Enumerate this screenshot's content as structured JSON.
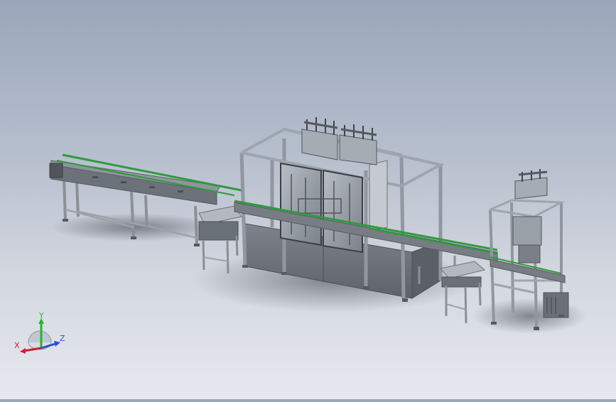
{
  "viewport": {
    "background_top": "#9aa7ba",
    "background_bottom": "#e6e8ee",
    "model_frame_color": "#8e949a",
    "model_panel_color": "#6f757c",
    "conveyor_belt_color": "#2f9a3e"
  },
  "triad": {
    "x_label": "X",
    "y_label": "Y",
    "z_label": "Z",
    "x_color": "#d11f2c",
    "y_color": "#27b23a",
    "z_color": "#2a4fd6"
  }
}
